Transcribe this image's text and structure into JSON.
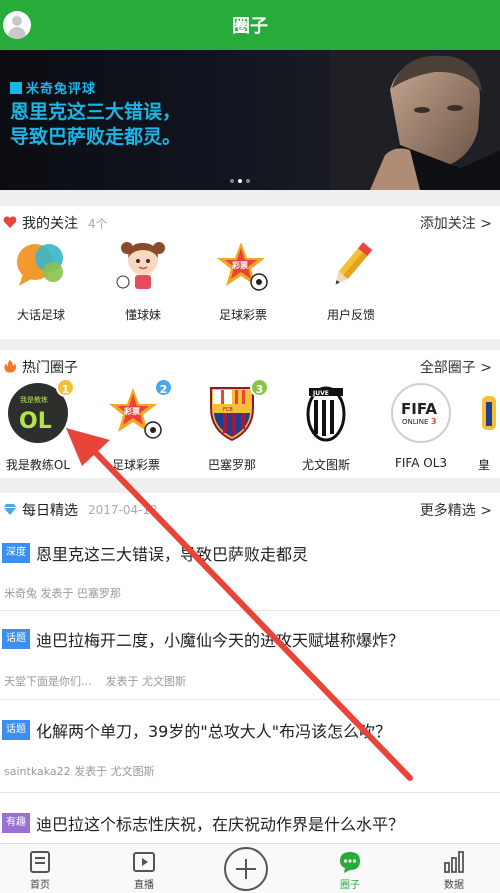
{
  "header": {
    "title": "圈子"
  },
  "banner": {
    "brand": "米奇兔评球",
    "title_line1": "恩里克这三大错误，",
    "title_line2": "导致巴萨败走都灵。"
  },
  "follow": {
    "title": "我的关注",
    "count": "4个",
    "more": "添加关注 >",
    "items": [
      {
        "label": "大话足球",
        "icon": "speech-bubbles-icon"
      },
      {
        "label": "懂球妹",
        "icon": "cartoon-girl-icon"
      },
      {
        "label": "足球彩票",
        "icon": "lottery-star-icon"
      },
      {
        "label": "用户反馈",
        "icon": "pencil-icon"
      }
    ]
  },
  "hot": {
    "title": "热门圈子",
    "more": "全部圈子 >",
    "items": [
      {
        "label": "我是教练OL",
        "badge": "1",
        "icon": "coach-ol-logo"
      },
      {
        "label": "足球彩票",
        "badge": "2",
        "icon": "lottery-star-icon"
      },
      {
        "label": "巴塞罗那",
        "badge": "3",
        "icon": "barcelona-crest"
      },
      {
        "label": "尤文图斯",
        "badge": "",
        "icon": "juventus-crest"
      },
      {
        "label": "FIFA OL3",
        "badge": "",
        "icon": "fifa-online3-logo"
      },
      {
        "label": "皇",
        "badge": "",
        "icon": "real-madrid-crest"
      }
    ]
  },
  "daily": {
    "title": "每日精选",
    "date": "2017-04-12",
    "more": "更多精选 >",
    "posts": [
      {
        "tag": "深度",
        "tag_color": "#3b8ff0",
        "title": "恩里克这三大错误，导致巴萨败走都灵",
        "author": "米奇兔",
        "posted_in": "发表于",
        "circle": "巴塞罗那"
      },
      {
        "tag": "话题",
        "tag_color": "#3b8ff0",
        "title": "迪巴拉梅开二度，小魔仙今天的进攻天赋堪称爆炸？",
        "author": "天堂下面是你们...",
        "posted_in": "发表于",
        "circle": "尤文图斯"
      },
      {
        "tag": "话题",
        "tag_color": "#3b8ff0",
        "title": "化解两个单刀，39岁的\"总攻大人\"布冯该怎么吹？",
        "author": "saintkaka22",
        "posted_in": "发表于",
        "circle": "尤文图斯"
      },
      {
        "tag": "有趣",
        "tag_color": "#9b6fd6",
        "title": "迪巴拉这个标志性庆祝，在庆祝动作界是什么水平？",
        "author": "",
        "posted_in": "",
        "circle": ""
      }
    ]
  },
  "tabs": [
    {
      "label": "首页",
      "icon": "home-doc-icon"
    },
    {
      "label": "直播",
      "icon": "play-icon"
    },
    {
      "label": "",
      "icon": "plus-circle-icon"
    },
    {
      "label": "圈子",
      "icon": "chat-bubble-icon"
    },
    {
      "label": "数据",
      "icon": "bar-chart-icon"
    }
  ],
  "colors": {
    "brand_green": "#27ab3a",
    "banner_text": "#19b6e6",
    "annotation_arrow": "#e8443a"
  }
}
